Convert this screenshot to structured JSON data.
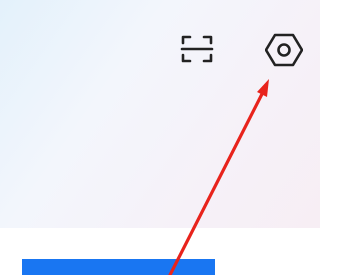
{
  "header": {
    "scan_button": {
      "icon": "scan-icon"
    },
    "settings_button": {
      "icon": "settings-icon"
    }
  },
  "annotation": {
    "type": "arrow",
    "color": "#e8231c",
    "points_to": "settings-button"
  },
  "colors": {
    "panel_gradient_start": "#e3f1fb",
    "panel_gradient_end": "#f7eef4",
    "primary_bar": "#1976f2",
    "icon_stroke": "#222222"
  }
}
